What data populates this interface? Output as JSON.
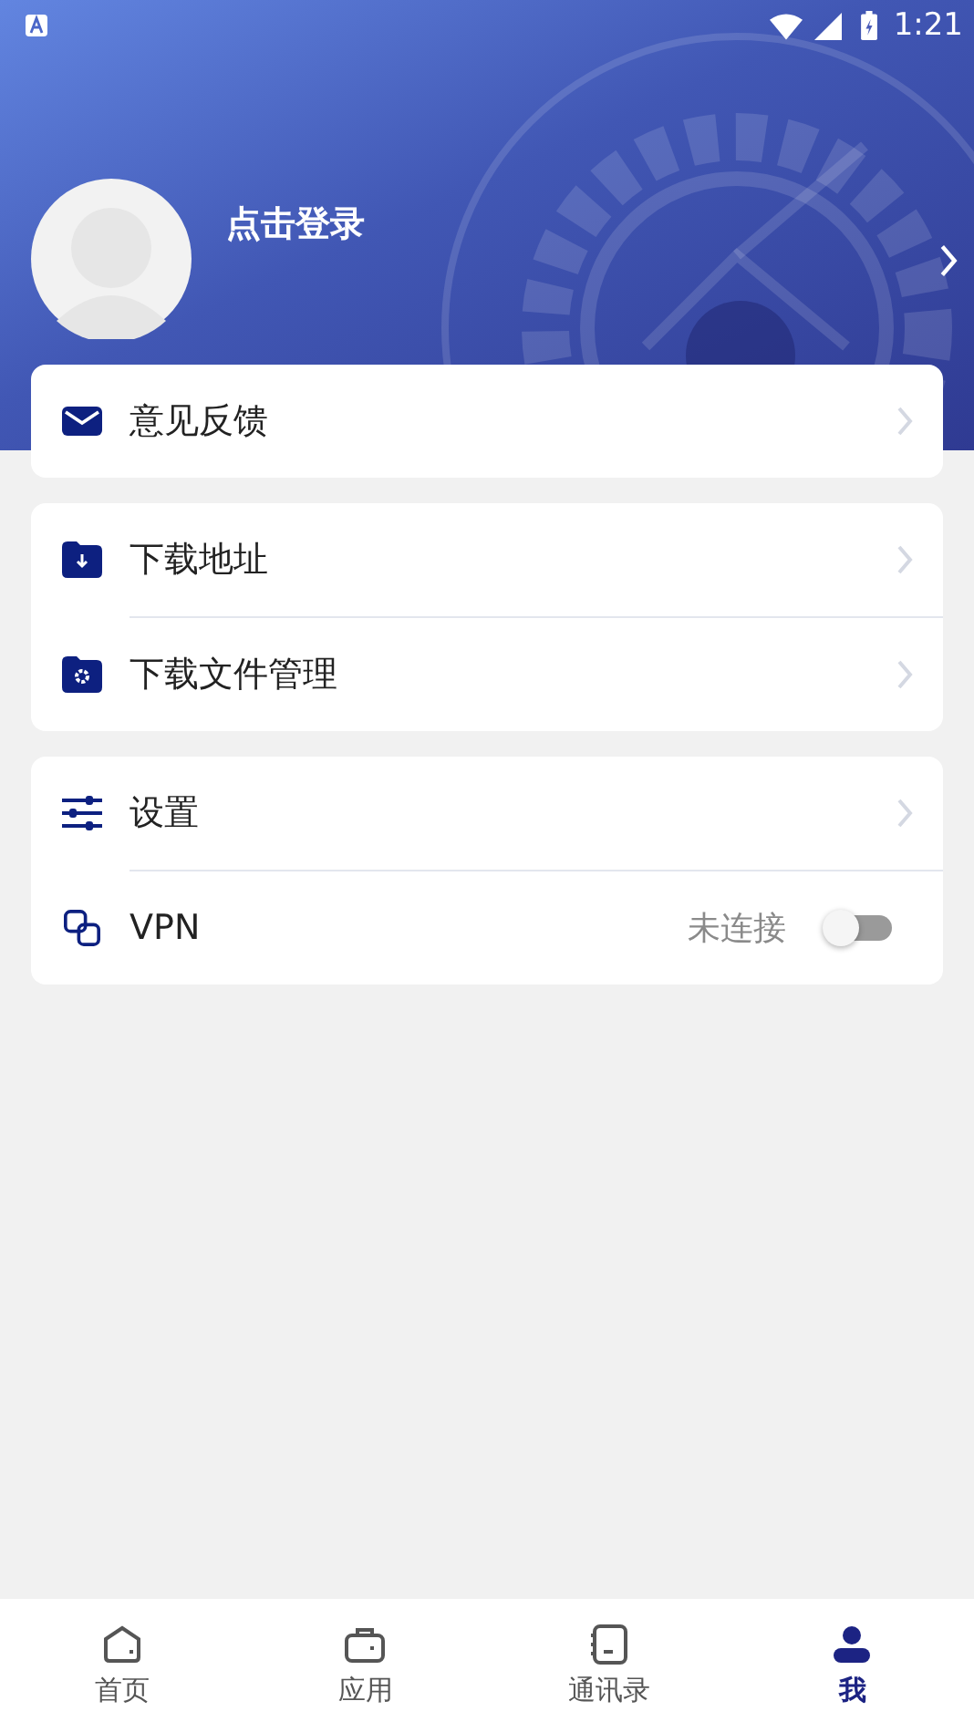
{
  "status_bar": {
    "time": "1:21"
  },
  "profile": {
    "login_text": "点击登录"
  },
  "groups": [
    {
      "items": [
        {
          "kind": "link",
          "label": "意见反馈"
        }
      ]
    },
    {
      "items": [
        {
          "kind": "link",
          "label": "下载地址"
        },
        {
          "kind": "link",
          "label": "下载文件管理"
        }
      ]
    },
    {
      "items": [
        {
          "kind": "link",
          "label": "设置"
        },
        {
          "kind": "toggle",
          "label": "VPN",
          "status": "未连接",
          "on": false
        }
      ]
    }
  ],
  "tabs": [
    {
      "label": "首页",
      "selected": false
    },
    {
      "label": "应用",
      "selected": false
    },
    {
      "label": "通讯录",
      "selected": false
    },
    {
      "label": "我",
      "selected": true
    }
  ]
}
